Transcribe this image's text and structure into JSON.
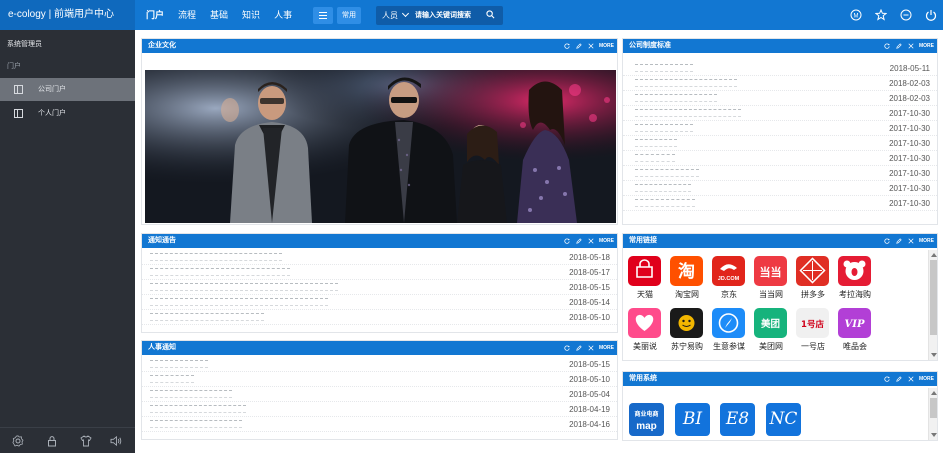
{
  "topbar": {
    "brand": "e-cology | 前端用户中心",
    "nav": [
      "门户",
      "流程",
      "基础",
      "知识",
      "人事"
    ],
    "common_label": "常用",
    "search": {
      "type": "人员",
      "placeholder": "请输入关键词搜索"
    },
    "icons": [
      "user-m-icon",
      "star-icon",
      "minus-circle-icon",
      "power-icon"
    ]
  },
  "sidebar": {
    "title": "系统管理员",
    "section": "门户",
    "items": [
      {
        "label": "公司门户",
        "active": true
      },
      {
        "label": "个人门户",
        "active": false
      }
    ],
    "footer_icons": [
      "settings-icon",
      "lock-icon",
      "shirt-icon",
      "speaker-icon"
    ]
  },
  "portlets": {
    "more_label": "MORE",
    "culture": {
      "title": "企业文化"
    },
    "notice": {
      "title": "通知通告",
      "rows": [
        {
          "date": "2018-05-18"
        },
        {
          "date": "2018-05-17"
        },
        {
          "date": "2018-05-15"
        },
        {
          "date": "2018-05-14"
        },
        {
          "date": "2018-05-10"
        }
      ]
    },
    "hr": {
      "title": "人事通知",
      "rows": [
        {
          "date": "2018-05-15"
        },
        {
          "date": "2018-05-10"
        },
        {
          "date": "2018-05-04"
        },
        {
          "date": "2018-04-19"
        },
        {
          "date": "2018-04-16"
        }
      ]
    },
    "policy": {
      "title": "公司制度标准",
      "rows": [
        {
          "date": "2018-05-11"
        },
        {
          "date": "2018-02-03"
        },
        {
          "date": "2018-02-03"
        },
        {
          "date": "2017-10-30"
        },
        {
          "date": "2017-10-30"
        },
        {
          "date": "2017-10-30"
        },
        {
          "date": "2017-10-30"
        },
        {
          "date": "2017-10-30"
        },
        {
          "date": "2017-10-30"
        },
        {
          "date": "2017-10-30"
        }
      ]
    },
    "links": {
      "title": "常用链接",
      "items": [
        {
          "name": "天猫",
          "logo": "tmall-logo",
          "color": "#e0001b",
          "mark": ""
        },
        {
          "name": "淘宝网",
          "logo": "taobao-logo",
          "color": "#ff5000",
          "mark": "淘"
        },
        {
          "name": "京东",
          "logo": "jd-logo",
          "color": "#e1251b",
          "mark": "JD.COM"
        },
        {
          "name": "当当网",
          "logo": "dangdang-logo",
          "color": "#ee3a43",
          "mark": "当当"
        },
        {
          "name": "拼多多",
          "logo": "pinduoduo-logo",
          "color": "#e02e24",
          "mark": ""
        },
        {
          "name": "考拉海购",
          "logo": "kaola-logo",
          "color": "#e51c34",
          "mark": ""
        },
        {
          "name": "美丽说",
          "logo": "meilishuo-logo",
          "color": "#ff4b8b",
          "mark": ""
        },
        {
          "name": "苏宁易购",
          "logo": "suning-logo",
          "color": "#1a1a1a",
          "mark": ""
        },
        {
          "name": "生意参谋",
          "logo": "shengyi-logo",
          "color": "#1d8cf8",
          "mark": ""
        },
        {
          "name": "美团网",
          "logo": "meituan-logo",
          "color": "#16b37c",
          "mark": "美团"
        },
        {
          "name": "一号店",
          "logo": "yhd-logo",
          "color": "#f0f0f0",
          "mark": "1号店"
        },
        {
          "name": "唯品会",
          "logo": "vip-logo",
          "color": "#b23fd6",
          "mark": "VIP"
        }
      ]
    },
    "systems": {
      "title": "常用系统",
      "items": [
        {
          "label": "商业电商 map",
          "logo": "map-system-icon"
        },
        {
          "label": "BI",
          "logo": "bi-system-icon"
        },
        {
          "label": "E8",
          "logo": "e8-system-icon"
        },
        {
          "label": "NC",
          "logo": "nc-system-icon"
        }
      ]
    }
  }
}
